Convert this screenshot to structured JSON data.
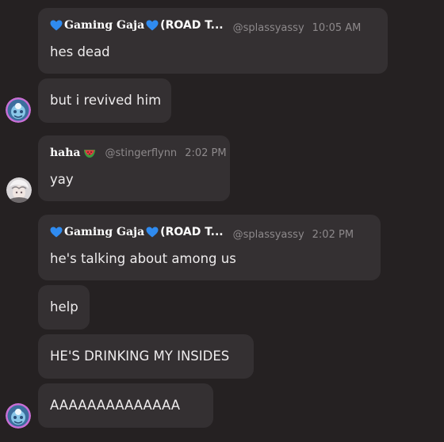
{
  "messages": [
    {
      "author": "Gaming Gaja",
      "author_suffix": "(ROAD T...",
      "handle": "@splassyassy",
      "time": "10:05 AM",
      "text": "hes dead"
    },
    {
      "text": "but i revived him"
    },
    {
      "author": "haha",
      "handle": "@stingerflynn",
      "time": "2:02 PM",
      "text": "yay"
    },
    {
      "author": "Gaming Gaja",
      "author_suffix": "(ROAD T...",
      "handle": "@splassyassy",
      "time": "2:02 PM",
      "text": "he's talking about among us"
    },
    {
      "text": "help"
    },
    {
      "text": "HE'S DRINKING MY INSIDES"
    },
    {
      "text": "AAAAAAAAAAAAAA"
    }
  ],
  "icons": {
    "author_emoji_left": "blue-heart-icon",
    "author_emoji_right": "blue-heart-icon",
    "second_author_emoji": "watermelon-icon"
  },
  "colors": {
    "background": "#252122",
    "bubble": "#343032",
    "heart": "#2f8bf0"
  }
}
